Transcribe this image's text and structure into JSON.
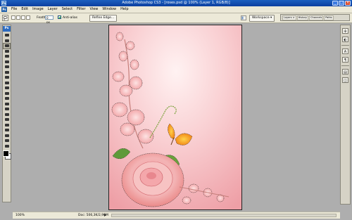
{
  "window": {
    "title": "Adobe Photoshop CS3 - [roses.psd @ 100% (Layer 1, RGB/8)]",
    "app_icon": "Ps",
    "buttons": [
      "minimize-icon",
      "maximize-icon",
      "close-icon"
    ]
  },
  "menubar": {
    "logo": "Ps",
    "items": [
      "File",
      "Edit",
      "Image",
      "Layer",
      "Select",
      "Filter",
      "View",
      "Window",
      "Help"
    ]
  },
  "options": {
    "tool_icon": "lasso-icon",
    "feather_label": "Feather:",
    "feather_value": "0 px",
    "antialias_label": "Anti-alias",
    "antialias_checked": true,
    "refine_edge": "Refine Edge...",
    "workspace": "Workspace ▾",
    "palette_well_tabs": [
      "Layers ×",
      "History",
      "Channels",
      "Paths"
    ]
  },
  "toolbox": {
    "logo": "Ps",
    "tools": [
      "move-tool",
      "marquee-tool",
      "lasso-tool",
      "magic-wand-tool",
      "crop-tool",
      "slice-tool",
      "healing-brush-tool",
      "brush-tool",
      "clone-stamp-tool",
      "history-brush-tool",
      "eraser-tool",
      "gradient-tool",
      "blur-tool",
      "dodge-tool",
      "pen-tool",
      "type-tool",
      "path-select-tool",
      "shape-tool",
      "notes-tool",
      "eyedropper-tool",
      "hand-tool",
      "zoom-tool"
    ],
    "active_tool": "lasso-tool",
    "foreground_color": "#000000",
    "background_color": "#ffffff"
  },
  "right_panel": {
    "icons": [
      "navigator-icon",
      "color-icon",
      "character-icon",
      "paragraph-icon",
      "layers-icon",
      "history-icon"
    ]
  },
  "statusbar": {
    "zoom": "100%",
    "doc_info": "Doc: 506,3K/2,90M"
  },
  "colors": {
    "canvas_bg": "#f4bcc0",
    "workspace_bg": "#aeaeae",
    "title_bar": "#0b3fa0"
  }
}
